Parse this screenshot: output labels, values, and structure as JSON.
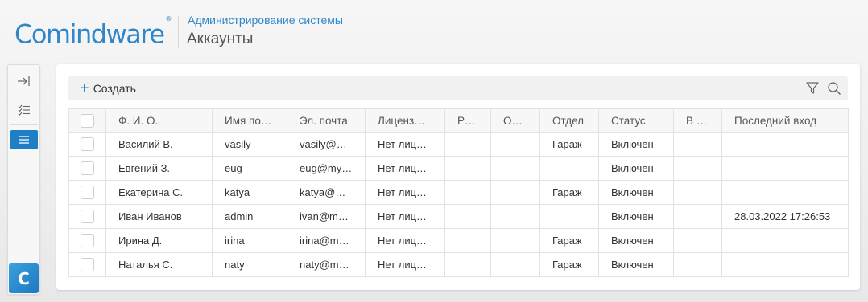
{
  "header": {
    "logo_text": "Comindware",
    "logo_mark": "®",
    "section_link": "Администрирование системы",
    "page_title": "Аккаунты"
  },
  "sidebar": {
    "items": [
      {
        "icon": "collapse-arrow-icon"
      },
      {
        "icon": "checklist-icon"
      },
      {
        "icon": "list-icon",
        "active": true
      }
    ],
    "app_logo_letter": "C"
  },
  "toolbar": {
    "create_label": "Создать",
    "filter_icon": "filter-icon",
    "search_icon": "search-icon"
  },
  "table": {
    "columns": [
      "Ф. И. О.",
      "Имя по…",
      "Эл. почта",
      "Лиценз…",
      "Ру…",
      "О…",
      "Отдел",
      "Статус",
      "В …",
      "Последний вход"
    ],
    "rows": [
      [
        "Василий В.",
        "vasily",
        "vasily@…",
        "Нет лице…",
        "",
        "",
        "Гараж",
        "Включен",
        "",
        ""
      ],
      [
        "Евгений З.",
        "eug",
        "eug@my…",
        "Нет лице…",
        "",
        "",
        "",
        "Включен",
        "",
        ""
      ],
      [
        "Екатерина С.",
        "katya",
        "katya@…",
        "Нет лице…",
        "",
        "",
        "Гараж",
        "Включен",
        "",
        ""
      ],
      [
        "Иван Иванов",
        "admin",
        "ivan@m…",
        "Нет лице…",
        "",
        "",
        "",
        "Включен",
        "",
        "28.03.2022 17:26:53"
      ],
      [
        "Ирина Д.",
        "irina",
        "irina@m…",
        "Нет лице…",
        "",
        "",
        "Гараж",
        "Включен",
        "",
        ""
      ],
      [
        "Наталья С.",
        "naty",
        "naty@m…",
        "Нет лице…",
        "",
        "",
        "Гараж",
        "Включен",
        "",
        ""
      ]
    ]
  },
  "colors": {
    "accent": "#2f86c8",
    "active_nav": "#1f7fc4"
  }
}
